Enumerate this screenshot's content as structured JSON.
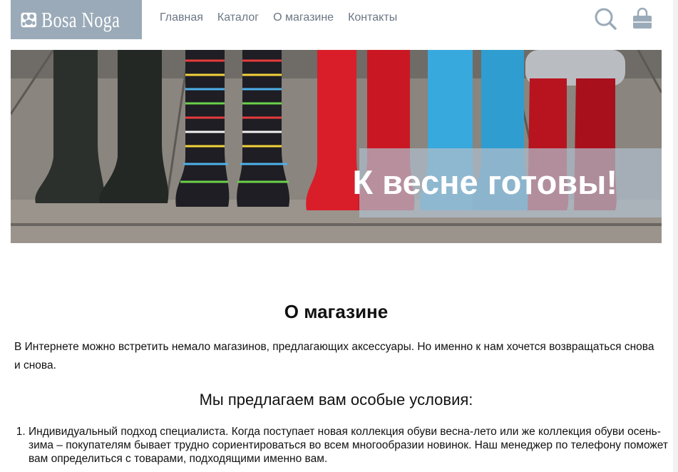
{
  "header": {
    "logo_text": "Bosa Noga",
    "nav": [
      {
        "label": "Главная"
      },
      {
        "label": "Каталог"
      },
      {
        "label": "О магазине"
      },
      {
        "label": "Контакты"
      }
    ],
    "icons": [
      "search-icon",
      "cart-icon"
    ],
    "logo_bg_color": "#9aaab8",
    "nav_color": "#6b7785"
  },
  "banner": {
    "title": "К весне готовы!",
    "overlay_color": "#b0becc"
  },
  "about": {
    "title": "О магазине",
    "text": "В Интернете можно встретить немало магазинов, предлагающих аксессуары. Но именно к нам хочется возвращаться снова и снова.",
    "offer_title": "Мы предлагаем вам особые условия:",
    "offers": [
      "Индивидуальный подход специалиста. Когда поступает новая коллекция обуви весна-лето или же коллекция обуви осень-зима – покупателям бывает трудно сориентироваться во всем многообразии новинок. Наш менеджер по телефону поможет вам определиться с товарами, подходящими именно вам."
    ]
  }
}
